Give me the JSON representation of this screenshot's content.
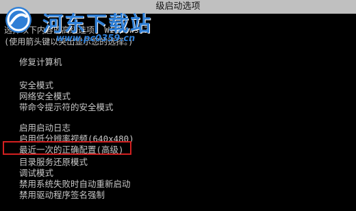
{
  "window": {
    "title": "级启动选项"
  },
  "header": {
    "line1": "选择以下内容的高级选项: Windows 7",
    "line2": "(使用箭头键以突出显示您的选择。)"
  },
  "menu": {
    "items": [
      "修复计算机",
      "安全模式",
      "网络安全模式",
      "带命令提示符的安全模式",
      "启用启动日志",
      "启用低分辨率视频(640x480)",
      "最近一次的正确配置(高级)",
      "目录服务还原模式",
      "调试模式",
      "禁用系统失败时自动重新启动",
      "禁用驱动程序签名强制"
    ],
    "selected_index": 6
  },
  "watermark": {
    "text": "河东下载站",
    "url": "www.pc0359.cn",
    "icon": "logo-icon"
  },
  "colors": {
    "background": "#000000",
    "text": "#c8c8c8",
    "titlebar": "#c0c0c0",
    "highlight_border": "#d42020",
    "watermark": "#2f7fd6"
  }
}
